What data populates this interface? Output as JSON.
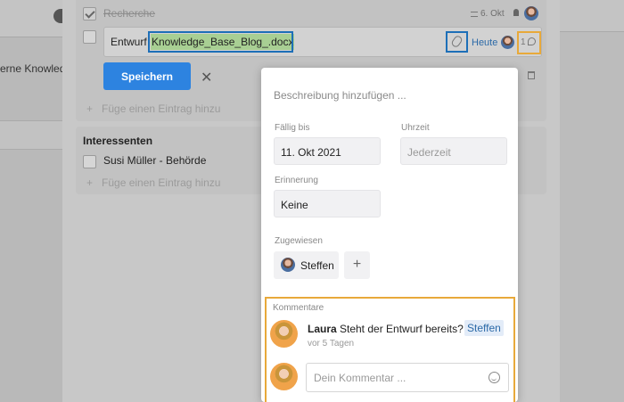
{
  "background": {
    "left_text": "erne Knowled"
  },
  "checklist": {
    "done_item": {
      "label": "Recherche",
      "date": "6. Okt"
    },
    "edit_item": {
      "prefix": "Entwurf",
      "highlighted": "Knowledge_Base_Blog_.docx",
      "due_label": "Heute",
      "comment_count": "1"
    },
    "save_label": "Speichern",
    "cancel_glyph": "✕",
    "add_entry_placeholder": "Füge einen Eintrag hinzu"
  },
  "interessenten": {
    "title": "Interessenten",
    "items": [
      "Susi Müller - Behörde"
    ],
    "add_entry_placeholder": "Füge einen Eintrag hinzu"
  },
  "details": {
    "description_placeholder": "Beschreibung hinzufügen ...",
    "due_label": "Fällig bis",
    "due_value": "11. Okt 2021",
    "time_label": "Uhrzeit",
    "time_placeholder": "Jederzeit",
    "reminder_label": "Erinnerung",
    "reminder_value": "Keine",
    "assigned_label": "Zugewiesen",
    "assignee": "Steffen",
    "add_assignee_glyph": "+"
  },
  "comments": {
    "title": "Kommentare",
    "items": [
      {
        "author": "Laura",
        "text": "Steht der Entwurf bereits?",
        "mention": "Steffen",
        "time": "vor 5 Tagen"
      }
    ],
    "input_placeholder": "Dein Kommentar ..."
  },
  "colors": {
    "accent": "#2d83e0",
    "highlight_box": "#1d6fb8",
    "comment_highlight": "#e8a93a",
    "text_highlight": "#a8cf93"
  }
}
